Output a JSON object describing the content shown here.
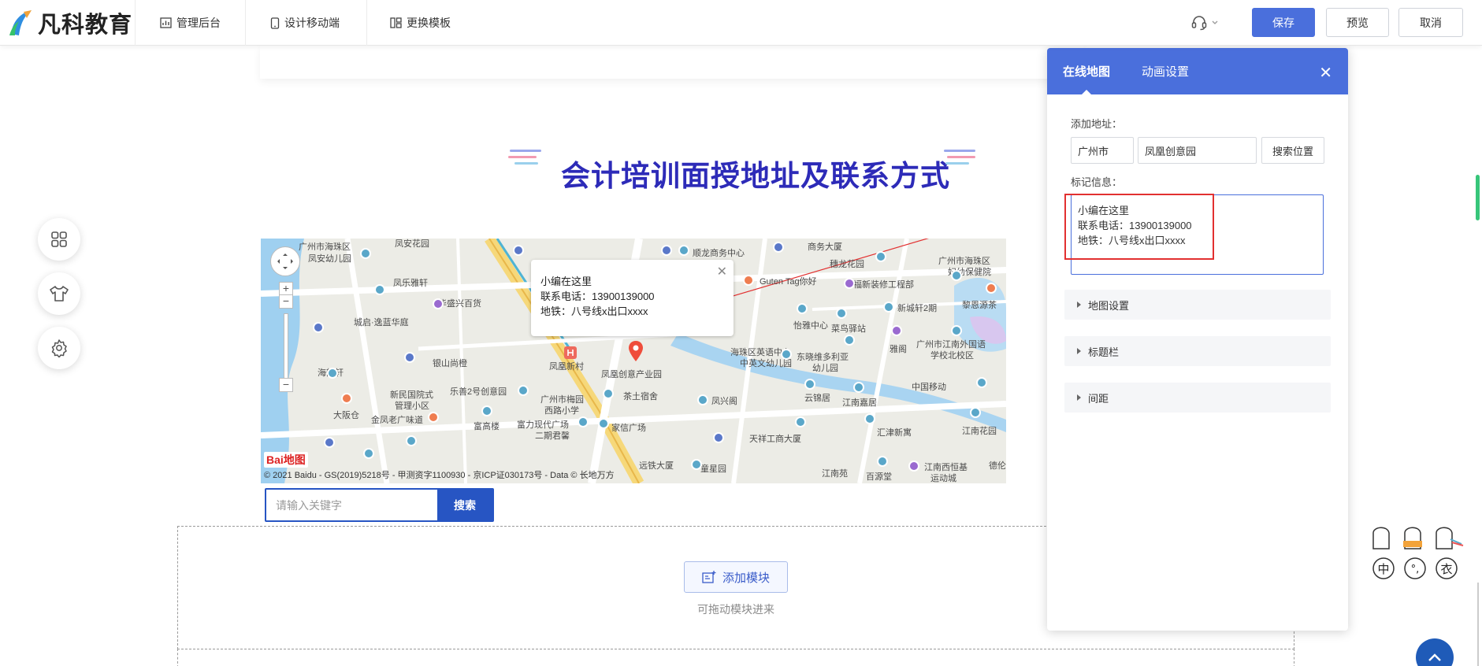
{
  "brand": {
    "name": "凡科教育",
    "accent": "#4a6fdc"
  },
  "topnav": [
    {
      "label": "管理后台",
      "icon": "chart-icon"
    },
    {
      "label": "设计移动端",
      "icon": "mobile-icon"
    },
    {
      "label": "更换模板",
      "icon": "template-icon"
    }
  ],
  "actions": {
    "save": "保存",
    "preview": "预览",
    "cancel": "取消"
  },
  "section": {
    "title": "会计培训面授地址及联系方式"
  },
  "map": {
    "popup": {
      "line1": "小编在这里",
      "line2": "联系电话：13900139000",
      "line3": "地铁：八号线x出口xxxx"
    },
    "search_placeholder": "请输入关键字",
    "search_button": "搜索",
    "copyright": "© 2021 Baidu - GS(2019)5218号 - 甲测资字1100930 - 京ICP证030173号 - Data © 长地万方",
    "baidu_logo": "Bai地图",
    "labels": {
      "l1": "广州市海珠区",
      "l2": "凤安幼儿园",
      "l3": "凤乐雅轩",
      "l4": "华盛兴百货",
      "l5": "城启·逸蓝华庭",
      "l6": "银山尚橙",
      "l7": "海韵轩",
      "l8": "新民国院式",
      "l9": "管理小区",
      "l10": "大阪仓",
      "l11": "乐善2号创意园",
      "l12": "金凤老广味道",
      "l13": "广州市梅园",
      "l14": "西路小学",
      "l15": "富高楼",
      "l16": "富力现代广场",
      "l17": "二期君馨",
      "l18": "凤凰新村",
      "l19": "凤凰创意产业园",
      "l20": "茶土宿舍",
      "l21": "家信广场",
      "l22": "顺龙商务中心",
      "l23": "商务大厦",
      "l24": "穗龙花园",
      "l25": "福新装修工程部",
      "l26": "新城轩2期",
      "l27": "怡雅中心",
      "l28": "菜鸟驿站",
      "l29": "海珠区英语中心",
      "l30": "中英文幼儿园",
      "l31": "东晓维多利亚",
      "l32": "幼儿园",
      "l33": "凤兴阁",
      "l34": "云锦居",
      "l35": "江南嘉居",
      "l36": "天祥工商大厦",
      "l37": "汇津新寓",
      "l38": "江南苑",
      "l39": "百源堂",
      "l40": "江南西恒基",
      "l41": "运动城",
      "l42": "中国移动",
      "l43": "江南花园",
      "l44": "广州市海珠区",
      "l45": "妇幼保健院",
      "l46": "黎恩源茶",
      "l47": "广州市江南外国语",
      "l48": "学校北校区",
      "l49": "雅阁",
      "l50": "远铁大厦",
      "l51": "童星园",
      "l52": "德伦",
      "l53": "凤安花园",
      "l54": "Guten Tag你好"
    }
  },
  "dropzone": {
    "add_module": "添加模块",
    "hint": "可拖动模块进来"
  },
  "left_toolbar": [
    {
      "icon": "grid-icon"
    },
    {
      "icon": "shirt-icon"
    },
    {
      "icon": "settings-icon"
    }
  ],
  "panel": {
    "tabs": [
      "在线地图",
      "动画设置"
    ],
    "add_address_label": "添加地址：",
    "city": "广州市",
    "address": "凤凰创意园",
    "search_location": "搜索位置",
    "marker_label": "标记信息：",
    "marker_text": "小编在这里\n联系电话：13900139000\n地铁：八号线x出口xxxx",
    "sections": [
      "地图设置",
      "标题栏",
      "间距"
    ]
  },
  "mascot": {
    "chars": [
      "中",
      "°,",
      "衣"
    ]
  }
}
